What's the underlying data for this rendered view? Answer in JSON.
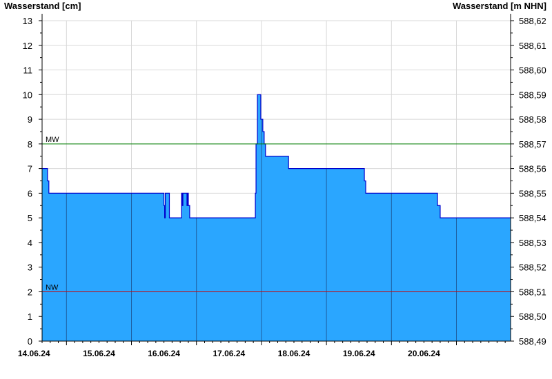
{
  "chart_data": {
    "type": "area",
    "y_left_label": "Wasserstand [cm]",
    "y_right_label": "Wasserstand [m NHN]",
    "ylim": [
      0,
      13
    ],
    "y_left_ticks": [
      "0",
      "1",
      "2",
      "3",
      "4",
      "5",
      "6",
      "7",
      "8",
      "9",
      "10",
      "11",
      "12",
      "13"
    ],
    "y_right_ticks": [
      "588,49",
      "588,50",
      "588,51",
      "588,52",
      "588,53",
      "588,54",
      "588,55",
      "588,56",
      "588,57",
      "588,58",
      "588,59",
      "588,60",
      "588,61",
      "588,62"
    ],
    "xlim": [
      "13.06.2024 15:00",
      "20.06.2024 20:00"
    ],
    "x_day_labels": [
      "14.06.24",
      "15.06.24",
      "16.06.24",
      "17.06.24",
      "18.06.24",
      "19.06.24",
      "20.06.24"
    ],
    "grid": true,
    "reference_lines": [
      {
        "name": "MW",
        "value": 8,
        "color": "#008000"
      },
      {
        "name": "NW",
        "value": 2,
        "color": "#cc0000"
      }
    ],
    "series": [
      {
        "color": "#2aa6ff",
        "edge_color": "#0000cc",
        "x": [
          "13.06.2024 15:00",
          "13.06.2024 17:00",
          "13.06.2024 17:00",
          "13.06.2024 17:30",
          "13.06.2024 17:30",
          "13.06.2024 18:00",
          "13.06.2024 18:00",
          "15.06.2024 12:00",
          "15.06.2024 12:00",
          "15.06.2024 12:15",
          "15.06.2024 12:15",
          "15.06.2024 12:30",
          "15.06.2024 12:30",
          "15.06.2024 14:00",
          "15.06.2024 14:00",
          "15.06.2024 18:30",
          "15.06.2024 18:30",
          "15.06.2024 18:45",
          "15.06.2024 18:45",
          "15.06.2024 19:00",
          "15.06.2024 19:00",
          "15.06.2024 20:30",
          "15.06.2024 20:30",
          "15.06.2024 20:45",
          "15.06.2024 20:45",
          "15.06.2024 21:00",
          "15.06.2024 21:00",
          "15.06.2024 21:30",
          "15.06.2024 21:30",
          "15.06.2024 21:45",
          "15.06.2024 21:45",
          "16.06.2024 21:45",
          "16.06.2024 21:45",
          "16.06.2024 22:00",
          "16.06.2024 22:00",
          "16.06.2024 22:30",
          "16.06.2024 22:30",
          "16.06.2024 23:45",
          "16.06.2024 23:45",
          "17.06.2024 00:30",
          "17.06.2024 00:30",
          "17.06.2024 01:00",
          "17.06.2024 01:00",
          "17.06.2024 01:30",
          "17.06.2024 01:30",
          "17.06.2024 10:00",
          "17.06.2024 10:00",
          "17.06.2024 10:30",
          "17.06.2024 10:30",
          "18.06.2024 14:00",
          "18.06.2024 14:00",
          "18.06.2024 14:30",
          "18.06.2024 14:30",
          "19.06.2024 17:00",
          "19.06.2024 17:00",
          "19.06.2024 18:00",
          "19.06.2024 18:00",
          "20.06.2024 20:00"
        ],
        "values": [
          7,
          7,
          6.5,
          6.5,
          6,
          6,
          6,
          6,
          5.5,
          5.5,
          5,
          5,
          6,
          6,
          5,
          5,
          6,
          6,
          5.5,
          5.5,
          6,
          6,
          5.5,
          5.5,
          6,
          6,
          5.5,
          5.5,
          5,
          5,
          5,
          5,
          6,
          6,
          8,
          8,
          10,
          10,
          9,
          9,
          8.5,
          8.5,
          8,
          8,
          7.5,
          7.5,
          7,
          7,
          7,
          7,
          6.5,
          6.5,
          6,
          6,
          5.5,
          5.5,
          5,
          5
        ]
      }
    ]
  }
}
